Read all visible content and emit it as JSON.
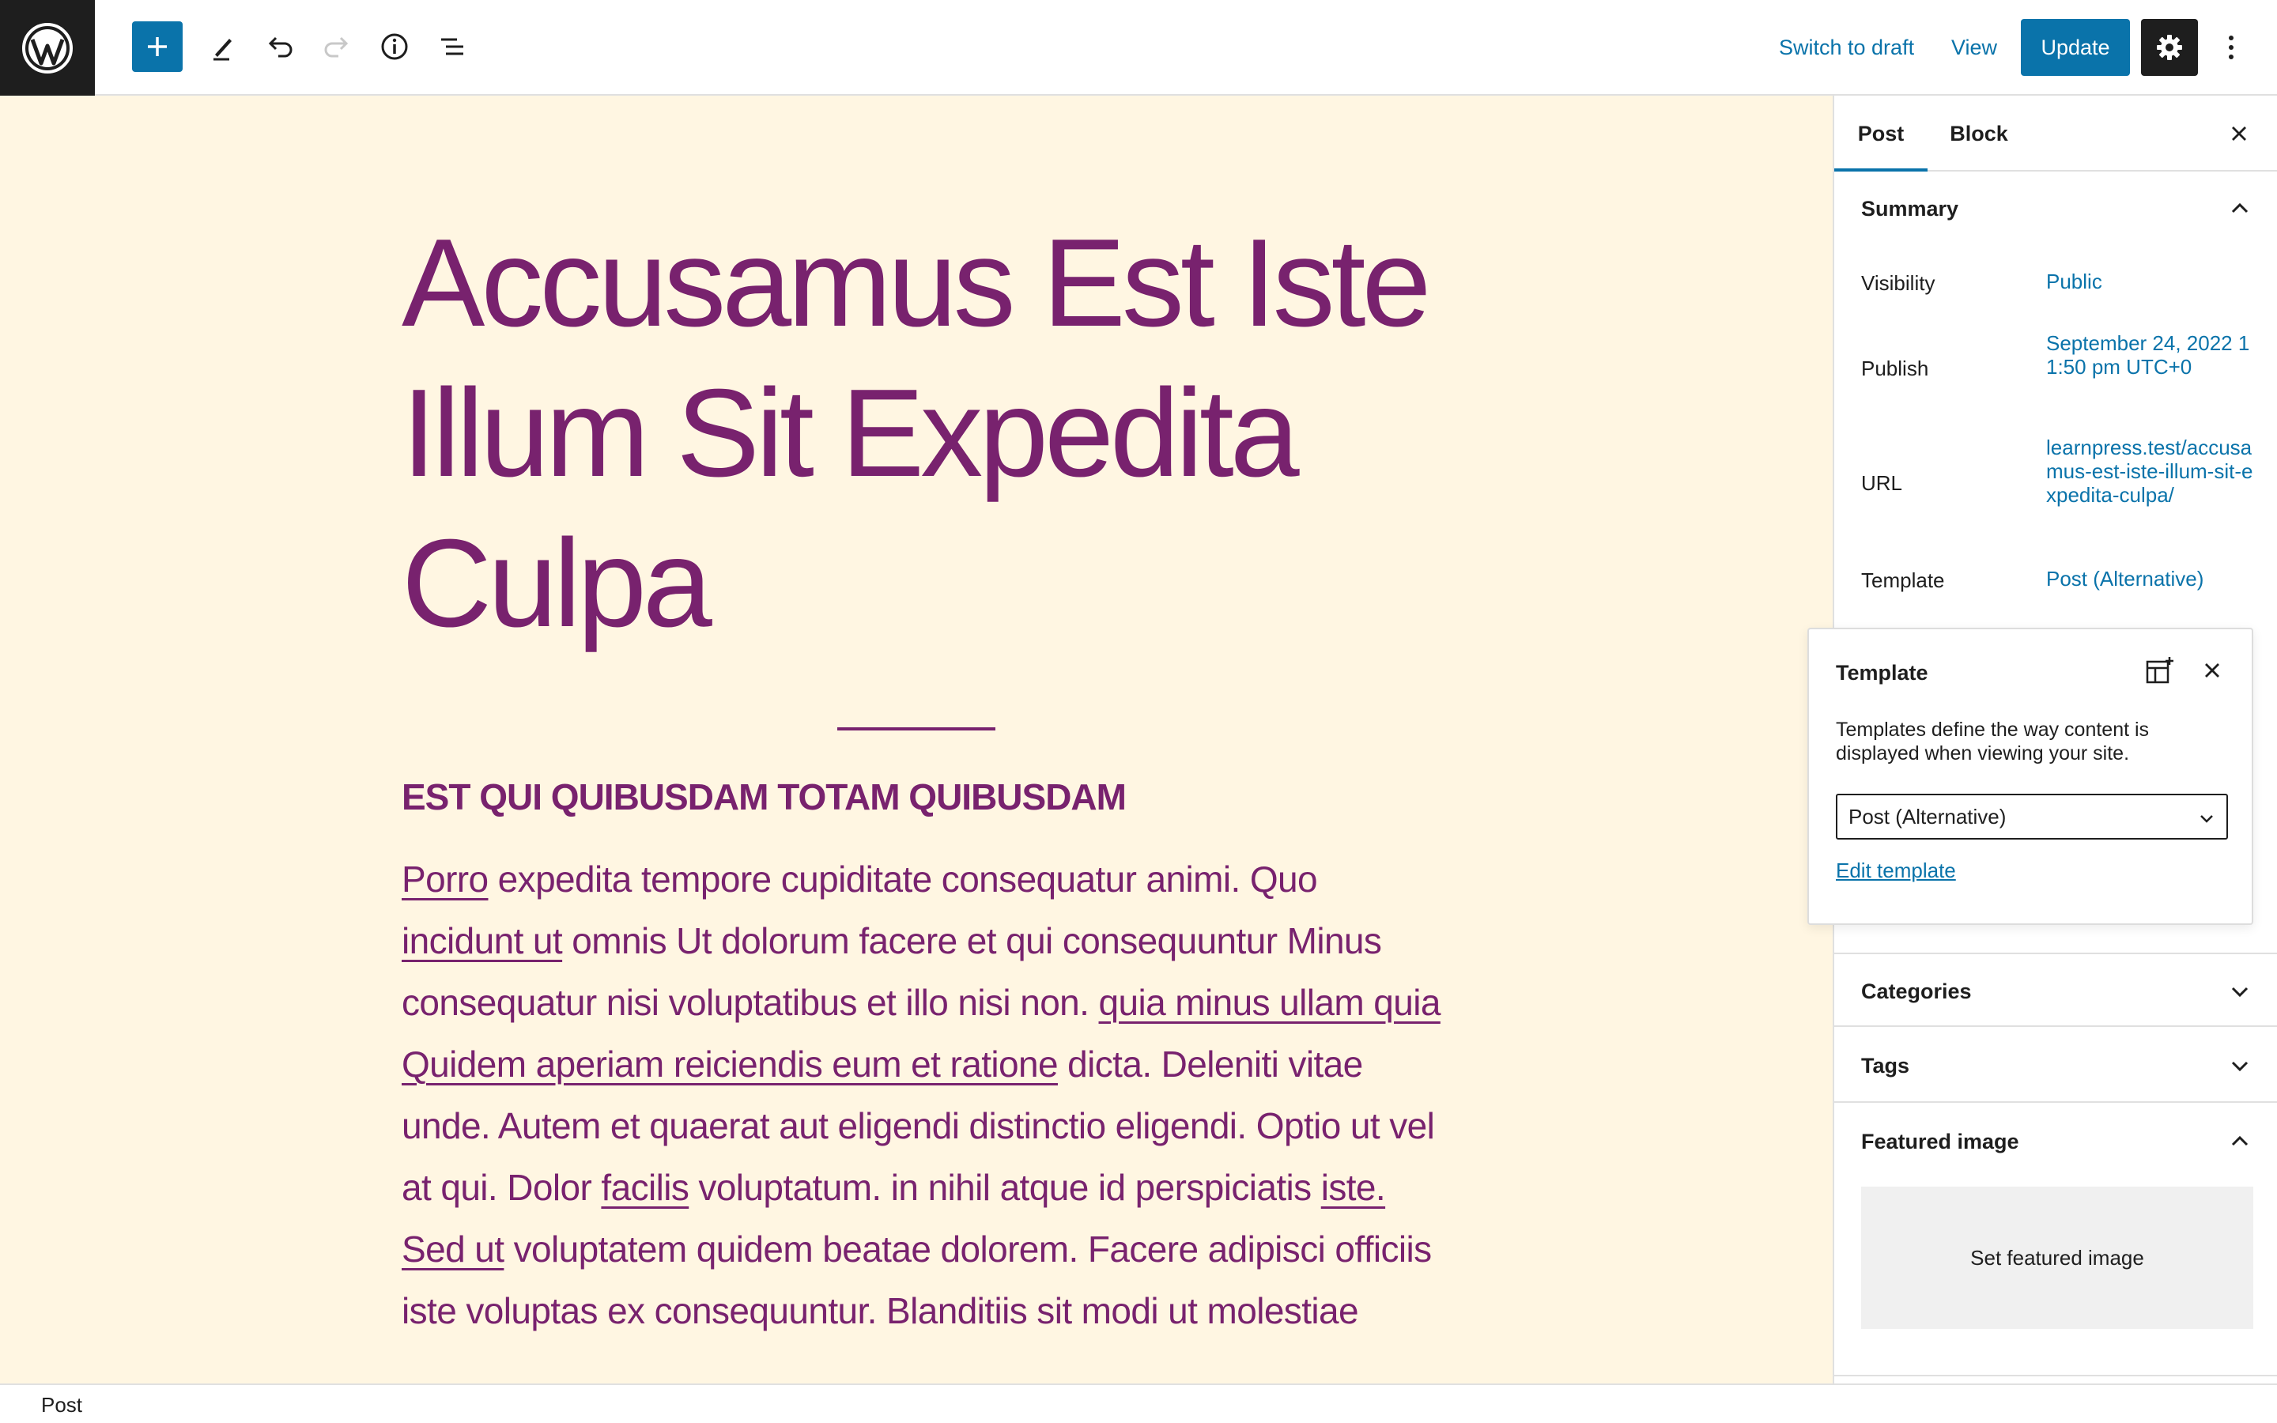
{
  "toolbar": {
    "switch_to_draft": "Switch to draft",
    "view": "View",
    "update": "Update",
    "icons": [
      "wordpress-logo",
      "plus-icon",
      "pencil-icon",
      "undo-icon",
      "redo-icon",
      "info-icon",
      "list-view-icon",
      "gear-icon",
      "more-vertical-icon"
    ],
    "accent_color": "#0a73aa"
  },
  "post": {
    "title": "Accusamus Est Iste Illum Sit Expedita Culpa",
    "subheading": "EST QUI QUIBUSDAM TOTAM QUIBUSDAM",
    "text_color": "#78226e",
    "background_color": "#fff6e2",
    "paragraph": [
      {
        "t": "Porro",
        "link": true
      },
      {
        "t": " expedita tempore cupiditate consequatur animi. Quo ",
        "link": false
      },
      {
        "t": "incidunt ut",
        "link": true
      },
      {
        "t": " omnis Ut dolorum facere et qui consequuntur Minus consequatur nisi voluptatibus et illo nisi non. ",
        "link": false
      },
      {
        "t": "quia minus ullam quia",
        "link": true
      },
      {
        "t": " ",
        "link": false
      },
      {
        "t": "Quidem aperiam reiciendis eum et ratione",
        "link": true
      },
      {
        "t": " dicta. Deleniti vitae unde. Autem et quaerat aut eligendi distinctio eligendi. Optio ut vel at qui. Dolor ",
        "link": false
      },
      {
        "t": "facilis",
        "link": true
      },
      {
        "t": " voluptatum. in nihil atque id perspiciatis ",
        "link": false
      },
      {
        "t": "iste. Sed ut",
        "link": true
      },
      {
        "t": " voluptatem quidem beatae dolorem. Facere adipisci officiis iste voluptas ex consequuntur. Blanditiis sit modi ut molestiae",
        "link": false
      }
    ]
  },
  "sidebar": {
    "tabs": [
      "Post",
      "Block"
    ],
    "summary": {
      "title": "Summary",
      "visibility_label": "Visibility",
      "visibility_value": "Public",
      "publish_label": "Publish",
      "publish_value": "September 24, 2022 11:50 pm UTC+0",
      "url_label": "URL",
      "url_value": "learnpress.test/accusamus-est-iste-illum-sit-expedita-culpa/",
      "template_label": "Template",
      "template_value": "Post (Alternative)"
    },
    "categories": "Categories",
    "tags": "Tags",
    "featured_image": "Featured image",
    "set_featured_image": "Set featured image"
  },
  "popover": {
    "title": "Template",
    "description": "Templates define the way content is displayed when viewing your site.",
    "select_value": "Post (Alternative)",
    "edit_link": "Edit template"
  },
  "footer": {
    "breadcrumb": "Post"
  }
}
